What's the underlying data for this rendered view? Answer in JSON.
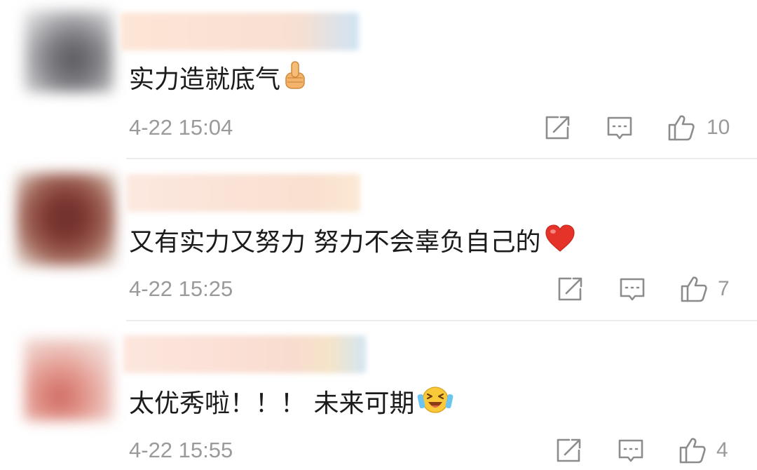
{
  "comments": [
    {
      "text": "实力造就底气",
      "emoji": "thumbs-up-emoji",
      "time": "4-22 15:04",
      "likes": "10"
    },
    {
      "text": "又有实力又努力 努力不会辜负自己的",
      "emoji": "red-heart-emoji",
      "time": "4-22 15:25",
      "likes": "7"
    },
    {
      "text": "太优秀啦！！！ 未来可期",
      "emoji": "laughing-tears-emoji",
      "time": "4-22 15:55",
      "likes": "4"
    }
  ],
  "icons": {
    "share": "share-icon",
    "reply": "reply-icon",
    "like": "like-icon"
  },
  "colors": {
    "text": "#1b1b1b",
    "meta": "#9a9a9a",
    "divider": "#ececec"
  }
}
